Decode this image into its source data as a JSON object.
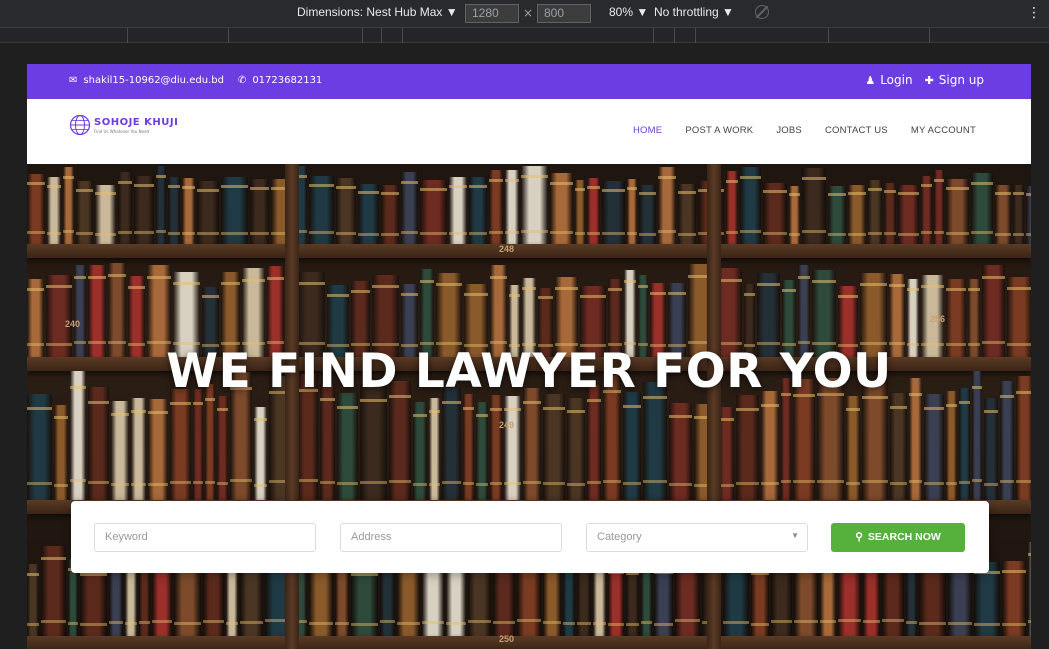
{
  "devtools": {
    "dimensions_label": "Dimensions: Nest Hub Max ▼",
    "width": "1280",
    "height": "800",
    "times": "×",
    "zoom": "80% ▼",
    "throttling": "No throttling ▼",
    "menu_glyph": "⋮"
  },
  "topbar": {
    "email_icon": "envelope-icon",
    "email": "shakil15-10962@diu.edu.bd",
    "phone_icon": "phone-icon",
    "phone": "01723682131",
    "login": "Login",
    "signup": "Sign up"
  },
  "logo": {
    "name": "SOHOJE KHUJI",
    "tagline": "Find Us Whatever You Need"
  },
  "menu": {
    "items": [
      "HOME",
      "POST A WORK",
      "JOBS",
      "CONTACT US",
      "MY ACCOUNT"
    ],
    "active": "HOME"
  },
  "hero": {
    "headline": "WE FIND LAWYER FOR YOU",
    "shelf_numbers": [
      "240",
      "248",
      "256",
      "249",
      "250"
    ]
  },
  "search": {
    "keyword_placeholder": "Keyword",
    "address_placeholder": "Address",
    "category_placeholder": "Category",
    "button": "SEARCH NOW"
  },
  "colors": {
    "accent": "#6c3de2",
    "button": "#55b03c"
  }
}
